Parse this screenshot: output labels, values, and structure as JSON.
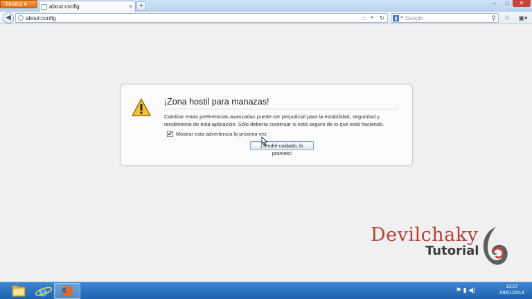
{
  "browser": {
    "menu_button_label": "Firefox",
    "tab_title": "about:config",
    "tab_close_glyph": "×",
    "new_tab_glyph": "+",
    "window_minimize": "–",
    "window_maximize": "□",
    "window_close": "✕",
    "address": "about:config",
    "search_placeholder": "Google",
    "search_engine_letter": "g"
  },
  "dialog": {
    "title": "¡Zona hostil para manazas!",
    "body": "Cambiar estas preferencias avanzadas puede ser perjudicial para la estabilidad, seguridad y rendimiento de esta aplicación. Sólo debería continuar si está seguro de lo que está haciendo.",
    "checkbox_label": "Mostrar esta advertencia la próxima vez",
    "checkbox_checked": true,
    "checkbox_mark": "✔",
    "button_label": "¡Tendré cuidado, lo prometo!"
  },
  "watermark": {
    "title": "Devilchaky",
    "subtitle": "Tutorial"
  },
  "taskbar": {
    "items": [
      "file-explorer",
      "internet-explorer",
      "firefox"
    ],
    "clock_time": "13:07",
    "clock_date": "09/01/2013"
  },
  "colors": {
    "warning_yellow": "#f2c12e",
    "watermark_red": "#b9413a",
    "taskbar_blue": "#1e63b1",
    "firefox_orange": "#e0701a"
  }
}
